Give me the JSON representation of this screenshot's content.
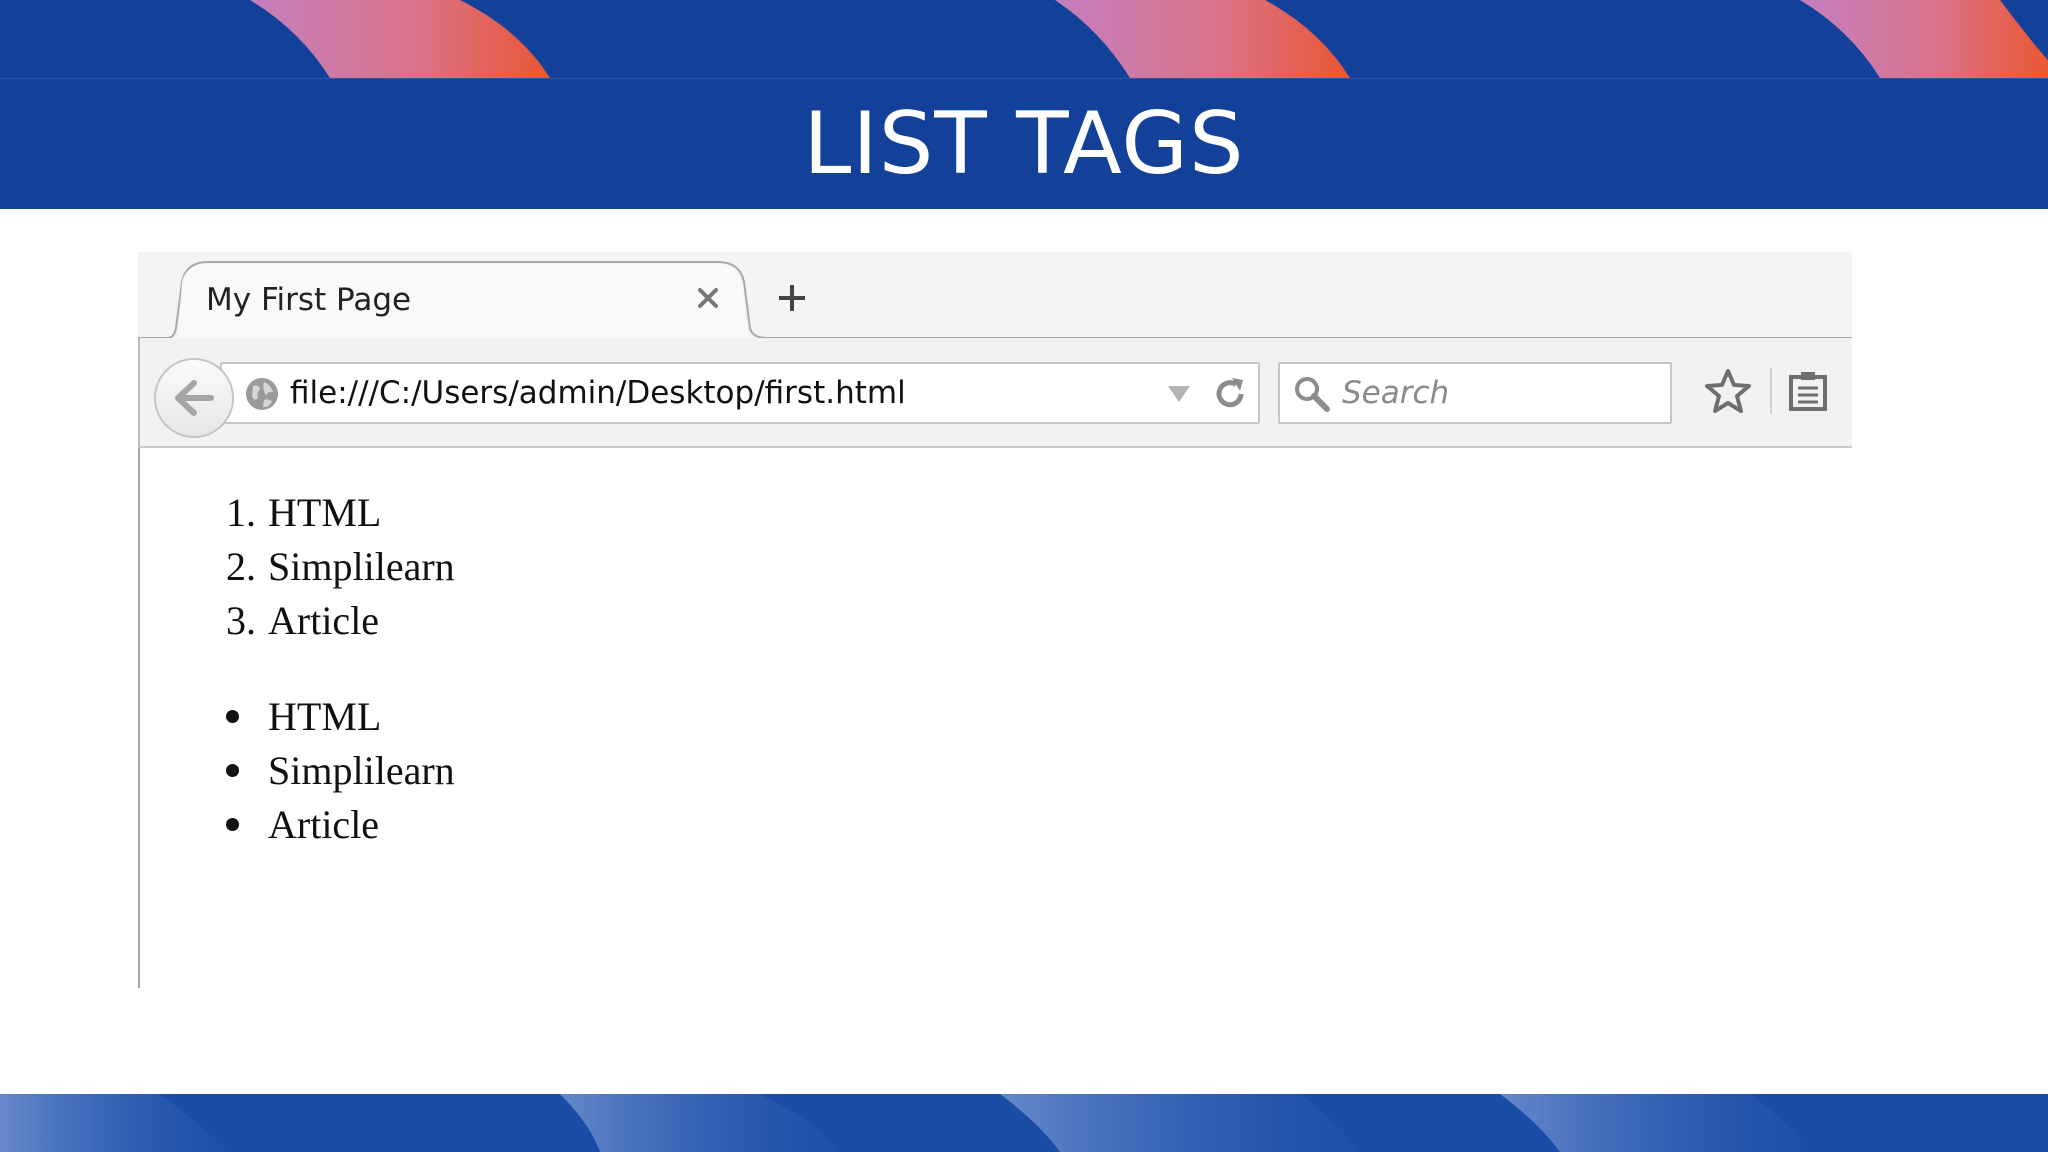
{
  "slide": {
    "title": "LIST TAGS"
  },
  "browser": {
    "tab": {
      "title": "My First Page"
    },
    "address": {
      "url": "file:///C:/Users/admin/Desktop/first.html"
    },
    "search": {
      "placeholder": "Search"
    }
  },
  "page": {
    "ordered_list": {
      "items": [
        "HTML",
        "Simplilearn",
        "Article"
      ],
      "markers": [
        "1.",
        "2.",
        "3."
      ]
    },
    "unordered_list": {
      "items": [
        "HTML",
        "Simplilearn",
        "Article"
      ]
    }
  },
  "colors": {
    "brand_blue": "#13419a",
    "accent_orange": "#e8553a",
    "accent_pink": "#c47fc0"
  },
  "icons": [
    "back-arrow-icon",
    "globe-icon",
    "dropdown-icon",
    "reload-icon",
    "search-icon",
    "star-icon",
    "reading-list-icon",
    "close-icon",
    "plus-icon"
  ]
}
